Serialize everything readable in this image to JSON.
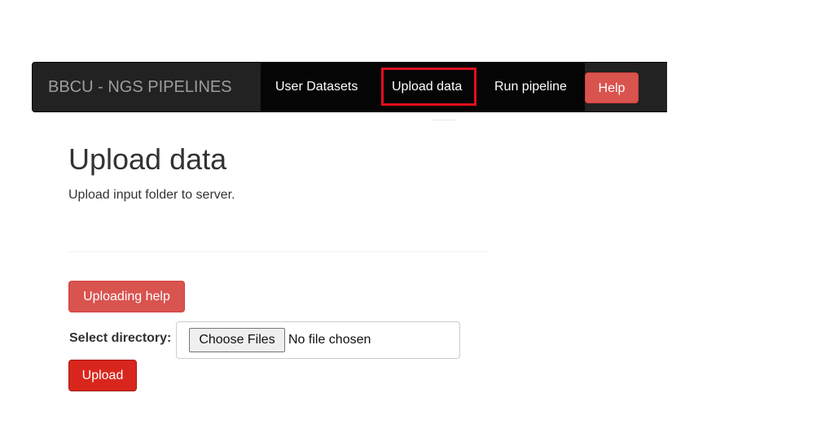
{
  "navbar": {
    "brand": "BBCU - NGS PIPELINES",
    "links": [
      {
        "label": "User Datasets"
      },
      {
        "label": "Upload data"
      },
      {
        "label": "Run pipeline"
      }
    ],
    "help_label": "Help"
  },
  "main": {
    "title": "Upload data",
    "subtitle": "Upload input folder to server.",
    "uploading_help_label": "Uploading help",
    "select_directory_label": "Select directory:",
    "file_input": {
      "button_label": "Choose Files",
      "status": "No file chosen"
    },
    "upload_label": "Upload"
  },
  "colors": {
    "navbar_bg": "#222222",
    "nav_group_bg": "#050505",
    "danger": "#d9534f",
    "upload_red": "#d9261c",
    "highlight": "#e0101e"
  }
}
